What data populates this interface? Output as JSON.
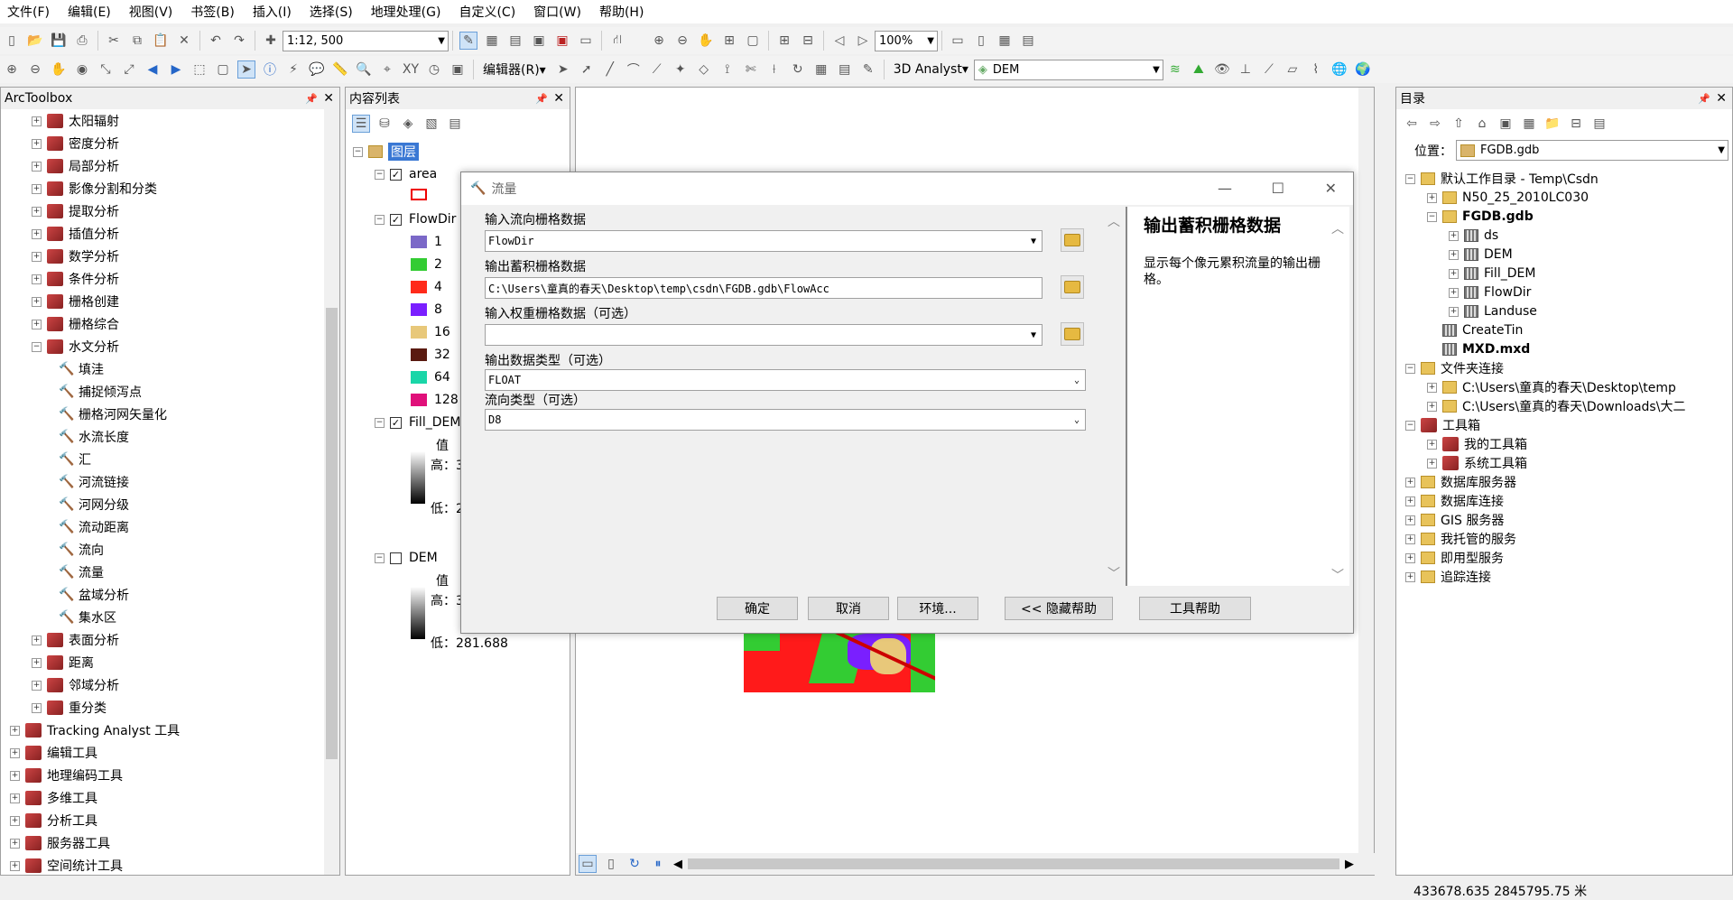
{
  "menu": [
    "文件(F)",
    "编辑(E)",
    "视图(V)",
    "书签(B)",
    "插入(I)",
    "选择(S)",
    "地理处理(G)",
    "自定义(C)",
    "窗口(W)",
    "帮助(H)"
  ],
  "toolbar": {
    "scale": "1:12, 500",
    "zoom": "100%",
    "editor": "编辑器(R)▾",
    "analyst": "3D Analyst▾",
    "layer": "DEM"
  },
  "arctoolbox": {
    "title": "ArcToolbox",
    "items": [
      {
        "l": "太阳辐射",
        "t": "box",
        "lvl": 1
      },
      {
        "l": "密度分析",
        "t": "box",
        "lvl": 1
      },
      {
        "l": "局部分析",
        "t": "box",
        "lvl": 1
      },
      {
        "l": "影像分割和分类",
        "t": "box",
        "lvl": 1
      },
      {
        "l": "提取分析",
        "t": "box",
        "lvl": 1
      },
      {
        "l": "插值分析",
        "t": "box",
        "lvl": 1
      },
      {
        "l": "数学分析",
        "t": "box",
        "lvl": 1
      },
      {
        "l": "条件分析",
        "t": "box",
        "lvl": 1
      },
      {
        "l": "栅格创建",
        "t": "box",
        "lvl": 1
      },
      {
        "l": "栅格综合",
        "t": "box",
        "lvl": 1
      },
      {
        "l": "水文分析",
        "t": "box",
        "lvl": 1,
        "open": true
      },
      {
        "l": "填洼",
        "t": "tool",
        "lvl": 2
      },
      {
        "l": "捕捉倾泻点",
        "t": "tool",
        "lvl": 2
      },
      {
        "l": "栅格河网矢量化",
        "t": "tool",
        "lvl": 2
      },
      {
        "l": "水流长度",
        "t": "tool",
        "lvl": 2
      },
      {
        "l": "汇",
        "t": "tool",
        "lvl": 2
      },
      {
        "l": "河流链接",
        "t": "tool",
        "lvl": 2
      },
      {
        "l": "河网分级",
        "t": "tool",
        "lvl": 2
      },
      {
        "l": "流动距离",
        "t": "tool",
        "lvl": 2
      },
      {
        "l": "流向",
        "t": "tool",
        "lvl": 2
      },
      {
        "l": "流量",
        "t": "tool",
        "lvl": 2
      },
      {
        "l": "盆域分析",
        "t": "tool",
        "lvl": 2
      },
      {
        "l": "集水区",
        "t": "tool",
        "lvl": 2
      },
      {
        "l": "表面分析",
        "t": "box",
        "lvl": 1
      },
      {
        "l": "距离",
        "t": "box",
        "lvl": 1
      },
      {
        "l": "邻域分析",
        "t": "box",
        "lvl": 1
      },
      {
        "l": "重分类",
        "t": "box",
        "lvl": 1
      },
      {
        "l": "Tracking Analyst 工具",
        "t": "box",
        "lvl": 0
      },
      {
        "l": "编辑工具",
        "t": "box",
        "lvl": 0
      },
      {
        "l": "地理编码工具",
        "t": "box",
        "lvl": 0
      },
      {
        "l": "多维工具",
        "t": "box",
        "lvl": 0
      },
      {
        "l": "分析工具",
        "t": "box",
        "lvl": 0
      },
      {
        "l": "服务器工具",
        "t": "box",
        "lvl": 0
      },
      {
        "l": "空间统计工具",
        "t": "box",
        "lvl": 0
      }
    ]
  },
  "toc": {
    "title": "内容列表",
    "root": "图层",
    "area": "area",
    "flowdir": "FlowDir",
    "classes": [
      {
        "v": "1",
        "c": "#7b68c8"
      },
      {
        "v": "2",
        "c": "#33cc33"
      },
      {
        "v": "4",
        "c": "#ff2a1a"
      },
      {
        "v": "8",
        "c": "#7a1fff"
      },
      {
        "v": "16",
        "c": "#e8c87a"
      },
      {
        "v": "32",
        "c": "#5a1a10"
      },
      {
        "v": "64",
        "c": "#1ad6a8"
      },
      {
        "v": "128",
        "c": "#e0107a"
      }
    ],
    "fill": "Fill_DEM",
    "val": "值",
    "high": "高：3",
    "low": "低：2",
    "dem": "DEM",
    "dem_high": "高：3",
    "dem_low": "低：281.688"
  },
  "dialog": {
    "title": "流量",
    "in_label": "输入流向栅格数据",
    "in_value": "FlowDir",
    "out_label": "输出蓄积栅格数据",
    "out_value": "C:\\Users\\童真的春天\\Desktop\\temp\\csdn\\FGDB.gdb\\FlowAcc",
    "weight_label": "输入权重栅格数据（可选）",
    "weight_value": "",
    "type_label": "输出数据类型（可选）",
    "type_value": "FLOAT",
    "dirtype_label": "流向类型（可选）",
    "dirtype_value": "D8",
    "help_title": "输出蓄积栅格数据",
    "help_text": "显示每个像元累积流量的输出栅格。",
    "ok": "确定",
    "cancel": "取消",
    "env": "环境...",
    "hide": "<< 隐藏帮助",
    "toolhelp": "工具帮助"
  },
  "catalog": {
    "title": "目录",
    "loc_label": "位置：",
    "loc": "FGDB.gdb",
    "items": [
      {
        "l": "默认工作目录 - Temp\\Csdn",
        "lvl": 0,
        "ic": "f",
        "exp": "-"
      },
      {
        "l": "N50_25_2010LC030",
        "lvl": 1,
        "ic": "f",
        "exp": "+"
      },
      {
        "l": "FGDB.gdb",
        "lvl": 1,
        "ic": "f",
        "exp": "-",
        "bold": true
      },
      {
        "l": "ds",
        "lvl": 2,
        "ic": "g",
        "exp": "+"
      },
      {
        "l": "DEM",
        "lvl": 2,
        "ic": "g",
        "exp": "+"
      },
      {
        "l": "Fill_DEM",
        "lvl": 2,
        "ic": "g",
        "exp": "+"
      },
      {
        "l": "FlowDir",
        "lvl": 2,
        "ic": "g",
        "exp": "+"
      },
      {
        "l": "Landuse",
        "lvl": 2,
        "ic": "g",
        "exp": "+"
      },
      {
        "l": "CreateTin",
        "lvl": 1,
        "ic": "g",
        "exp": ""
      },
      {
        "l": "MXD.mxd",
        "lvl": 1,
        "ic": "g",
        "exp": "",
        "bold": true
      },
      {
        "l": "文件夹连接",
        "lvl": 0,
        "ic": "f",
        "exp": "-"
      },
      {
        "l": "C:\\Users\\童真的春天\\Desktop\\temp",
        "lvl": 1,
        "ic": "f",
        "exp": "+"
      },
      {
        "l": "C:\\Users\\童真的春天\\Downloads\\大二",
        "lvl": 1,
        "ic": "f",
        "exp": "+"
      },
      {
        "l": "工具箱",
        "lvl": 0,
        "ic": "b",
        "exp": "-"
      },
      {
        "l": "我的工具箱",
        "lvl": 1,
        "ic": "b",
        "exp": "+"
      },
      {
        "l": "系统工具箱",
        "lvl": 1,
        "ic": "b",
        "exp": "+"
      },
      {
        "l": "数据库服务器",
        "lvl": 0,
        "ic": "f",
        "exp": "+"
      },
      {
        "l": "数据库连接",
        "lvl": 0,
        "ic": "f",
        "exp": "+"
      },
      {
        "l": "GIS 服务器",
        "lvl": 0,
        "ic": "f",
        "exp": "+"
      },
      {
        "l": "我托管的服务",
        "lvl": 0,
        "ic": "f",
        "exp": "+"
      },
      {
        "l": "即用型服务",
        "lvl": 0,
        "ic": "f",
        "exp": "+"
      },
      {
        "l": "追踪连接",
        "lvl": 0,
        "ic": "f",
        "exp": "+"
      }
    ]
  },
  "status": {
    "coords": "433678.635  2845795.75 米"
  }
}
